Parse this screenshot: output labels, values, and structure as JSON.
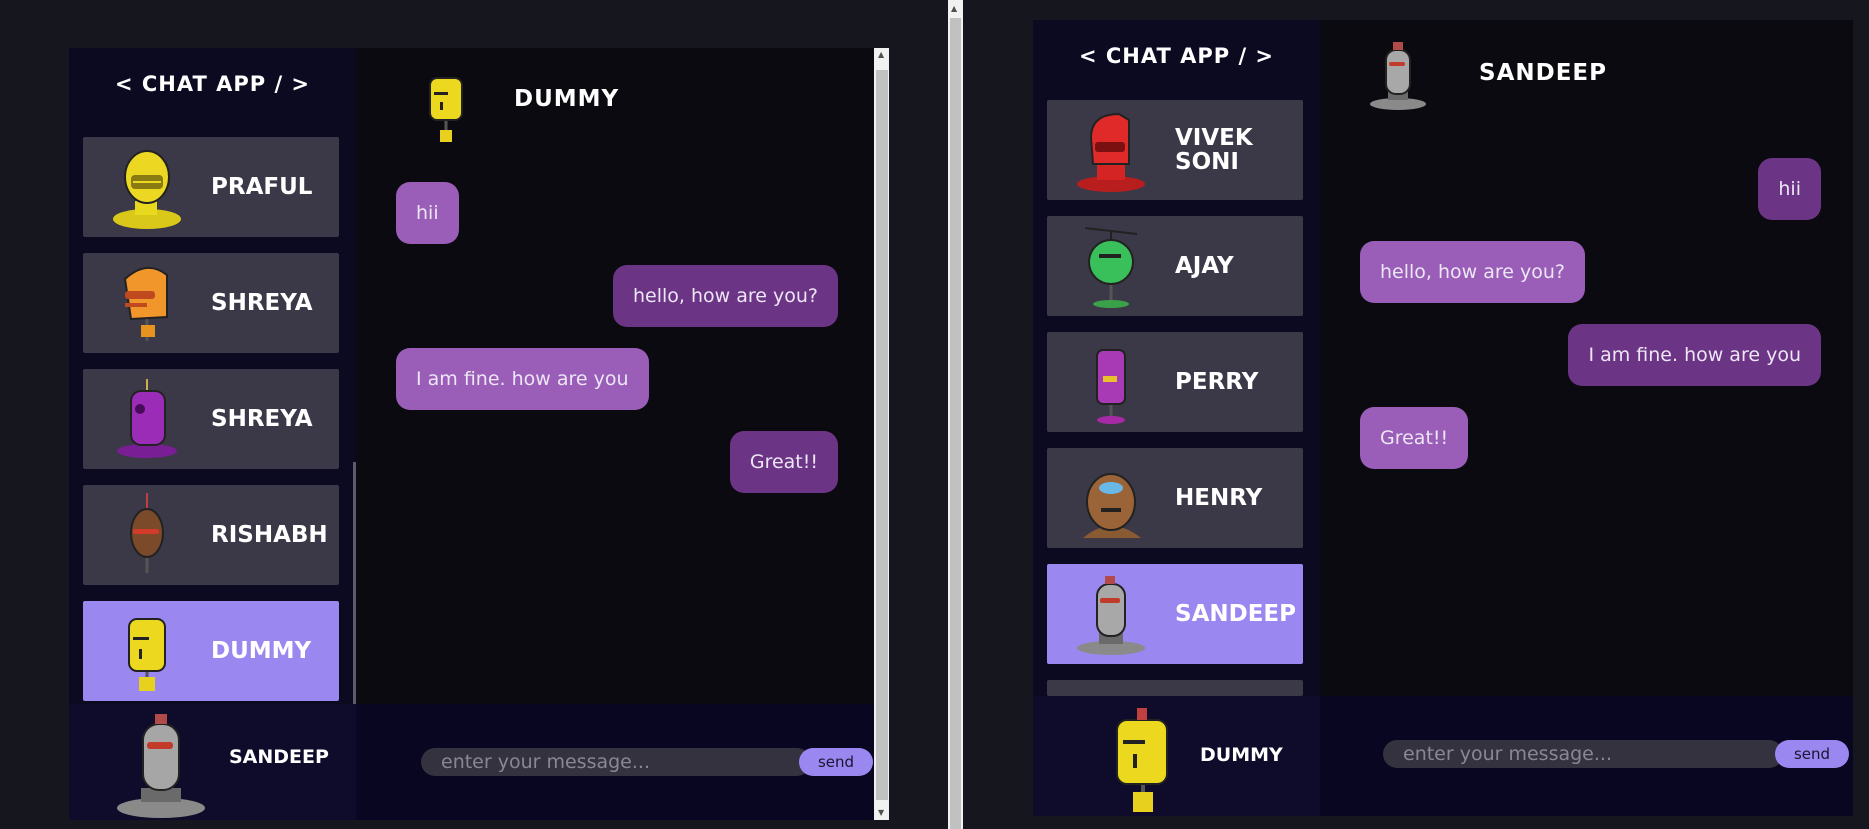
{
  "left": {
    "brand": "< CHAT APP / >",
    "contacts": [
      {
        "name": "PRAFUL",
        "avatar": "yellow-robot-icon",
        "active": false
      },
      {
        "name": "SHREYA",
        "avatar": "orange-robot-icon",
        "active": false
      },
      {
        "name": "SHREYA",
        "avatar": "purple-robot-icon",
        "active": false
      },
      {
        "name": "RISHABH",
        "avatar": "brown-robot-icon",
        "active": false
      },
      {
        "name": "DUMMY",
        "avatar": "yellow-robot-icon",
        "active": true
      }
    ],
    "chat": {
      "name": "DUMMY",
      "avatar": "yellow-robot-icon",
      "messages": [
        {
          "text": "hii",
          "dir": "in"
        },
        {
          "text": "hello, how are you?",
          "dir": "out"
        },
        {
          "text": "I am fine. how are you",
          "dir": "in"
        },
        {
          "text": "Great!!",
          "dir": "out"
        }
      ]
    },
    "me": {
      "name": "SANDEEP",
      "avatar": "silver-robot-icon"
    },
    "input_placeholder": "enter your message...",
    "send_label": "send"
  },
  "right": {
    "brand": "< CHAT APP / >",
    "contacts": [
      {
        "name": "VIVEK SONI",
        "avatar": "red-robot-icon",
        "active": false
      },
      {
        "name": "AJAY",
        "avatar": "green-robot-icon",
        "active": false
      },
      {
        "name": "PERRY",
        "avatar": "purple-robot-icon",
        "active": false
      },
      {
        "name": "HENRY",
        "avatar": "brown-robot-icon",
        "active": false
      },
      {
        "name": "SANDEEP",
        "avatar": "silver-robot-icon",
        "active": true
      }
    ],
    "chat": {
      "name": "SANDEEP",
      "avatar": "silver-robot-icon",
      "messages": [
        {
          "text": "hii",
          "dir": "out"
        },
        {
          "text": "hello, how are you?",
          "dir": "in"
        },
        {
          "text": "I am fine. how are you",
          "dir": "out"
        },
        {
          "text": "Great!!",
          "dir": "in"
        }
      ]
    },
    "me": {
      "name": "DUMMY",
      "avatar": "yellow-robot-icon"
    },
    "input_placeholder": "enter your message...",
    "send_label": "send"
  },
  "colors": {
    "page_bg": "#16161f",
    "sidebar_bg": "#0c0a20",
    "contact_bg": "#3b3848",
    "contact_active": "#9b87f0",
    "bubble_in": "#9a5db8",
    "bubble_out": "#6c3485",
    "send_button": "#9b87f0"
  }
}
